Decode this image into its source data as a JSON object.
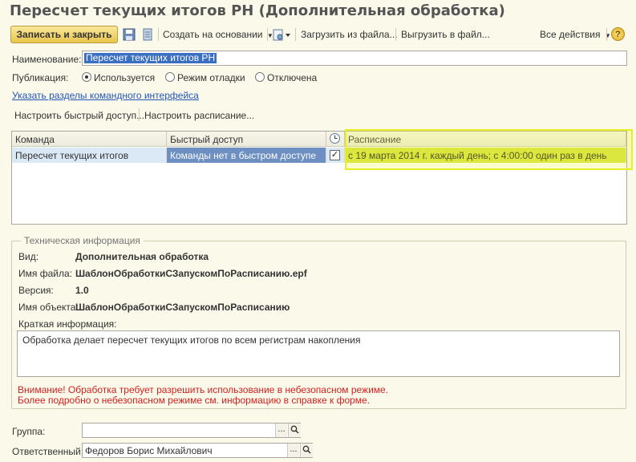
{
  "window": {
    "title": "Пересчет текущих итогов РН (Дополнительная обработка)"
  },
  "toolbar": {
    "write_close": "Записать и закрыть",
    "create_based": "Создать на основании",
    "load_file": "Загрузить из файла...",
    "unload_file": "Выгрузить в файл...",
    "all_actions": "Все действия",
    "help": "?"
  },
  "form": {
    "name_label": "Наименование:",
    "name_value": "Пересчет текущих итогов РН",
    "publication_label": "Публикация:",
    "publication_options": [
      "Используется",
      "Режим отладки",
      "Отключена"
    ],
    "publication_selected": 0,
    "sections_link": "Указать разделы командного интерфейса",
    "quick_access_btn": "Настроить быстрый доступ...",
    "schedule_btn": "Настроить расписание..."
  },
  "commands_table": {
    "headers": [
      "Команда",
      "Быстрый доступ",
      "",
      "Расписание"
    ],
    "rows": [
      {
        "command": "Пересчет текущих итогов",
        "quick_access": "Команды нет в быстром доступе",
        "checked": true,
        "schedule": "с 19 марта 2014 г. каждый  день; с 4:00:00 один раз в день"
      }
    ]
  },
  "tech_info": {
    "legend": "Техническая информация",
    "kind_label": "Вид:",
    "kind_value": "Дополнительная обработка",
    "file_label": "Имя файла:",
    "file_value": "ШаблонОбработкиСЗапускомПоРасписанию.epf",
    "version_label": "Версия:",
    "version_value": "1.0",
    "object_label": "Имя объекта:",
    "object_value": "ШаблонОбработкиСЗапускомПоРасписанию",
    "brief_label": "Краткая информация:",
    "brief_value": "Обработка делает пересчет текущих итогов по всем регистрам накопления",
    "warning_1": "Внимание! Обработка требует разрешить использование в небезопасном режиме.",
    "warning_2": "Более подробно о небезопасном режиме см. информацию в справке к форме."
  },
  "footer": {
    "group_label": "Группа:",
    "group_value": "",
    "responsible_label": "Ответственный:",
    "responsible_value": "Федоров Борис Михайлович",
    "dots": "...",
    "dots2": "..."
  },
  "colors": {
    "accent": "#e8c44c",
    "selection": "#3a6fc1",
    "highlight": "#e7ef20",
    "warning": "#d42020"
  }
}
